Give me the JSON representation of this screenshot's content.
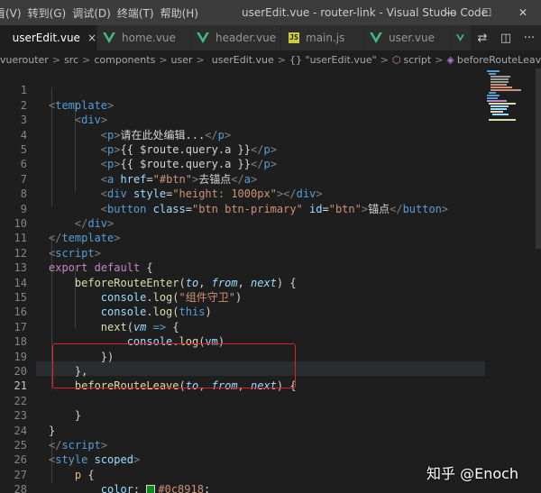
{
  "menu": [
    "看(V)",
    "转到(G)",
    "调试(D)",
    "终端(T)",
    "帮助(H)"
  ],
  "window_title": "userEdit.vue - router-link - Visual Studio Code",
  "window_controls": {
    "minimize": "—",
    "maximize": "☐",
    "close": "✕"
  },
  "tabs": [
    {
      "label": "userEdit.vue",
      "icon": "vue-icon",
      "active": true
    },
    {
      "label": "home.vue",
      "icon": "vue-icon",
      "active": false
    },
    {
      "label": "header.vue",
      "icon": "vue-icon",
      "active": false
    },
    {
      "label": "main.js",
      "icon": "js-icon",
      "active": false
    },
    {
      "label": "user.vue",
      "icon": "vue-icon",
      "active": false
    }
  ],
  "tab_close": "×",
  "tab_actions": [
    "⇄",
    "◫",
    "···"
  ],
  "breadcrumb": {
    "items": [
      "vuerouter",
      "src",
      "components",
      "user",
      "userEdit.vue",
      "{} \"userEdit.vue\"",
      "script",
      "beforeRouteLeave"
    ],
    "separator": ">"
  },
  "code": {
    "line_numbers": [
      "1",
      "2",
      "3",
      "4",
      "5",
      "6",
      "7",
      "8",
      "9",
      "10",
      "11",
      "12",
      "13",
      "14",
      "15",
      "16",
      "17",
      "18",
      "19",
      "20",
      "21",
      "22",
      "23",
      "24",
      "25",
      "26",
      "27",
      "28"
    ],
    "p_text": "请在此处编辑...",
    "mustache_a": "{{ $route.query.a }}",
    "href_attr": "href",
    "href_val": "\"#btn\"",
    "link_text": "去锚点",
    "style_attr": "style",
    "style_val": "\"height: 1000px\"",
    "class_attr": "class",
    "class_val": "\"btn btn-primary\"",
    "id_attr": "id",
    "id_val": "\"btn\"",
    "button_text": "锚点",
    "export": "export",
    "default": "default",
    "enter_fn": "beforeRouteEnter",
    "leave_fn": "beforeRouteLeave",
    "p_to": "to",
    "p_from": "from",
    "p_next": "next",
    "console": "console",
    "log": "log",
    "log_str": "\"组件守卫\"",
    "this": "this",
    "next_call": "next",
    "vm": "vm",
    "arrow": "=>",
    "scoped": "scoped",
    "selector_p": "p",
    "color_prop": "color",
    "color_value": "#0c8918"
  },
  "colors": {
    "swatch": "#0c8918",
    "highlight_box": "#e0202a"
  },
  "watermark": "知乎 @Enoch"
}
